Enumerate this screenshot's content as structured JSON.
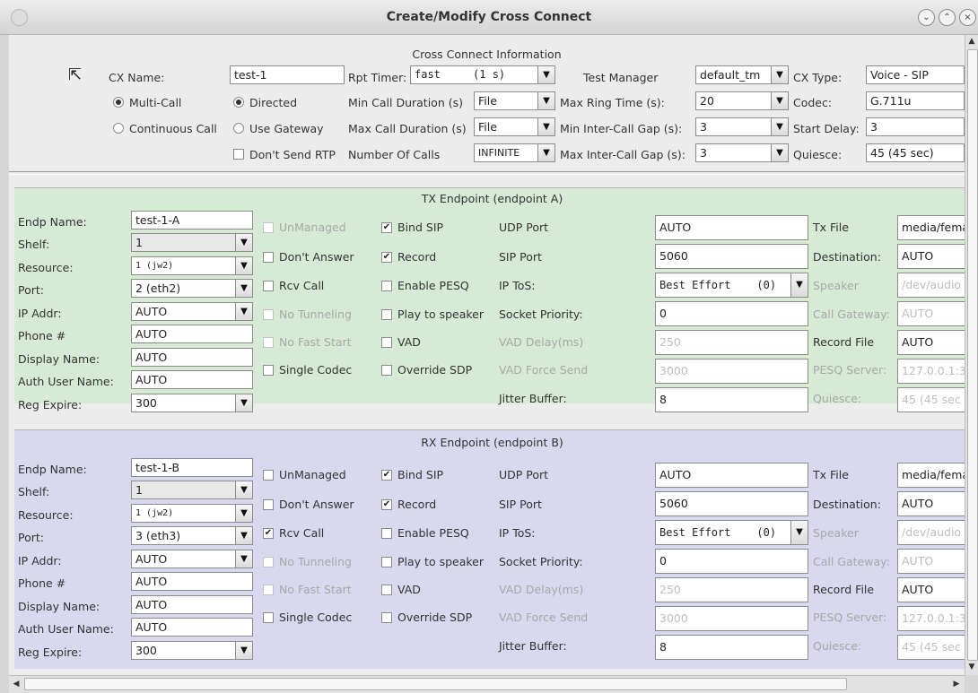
{
  "window": {
    "title": "Create/Modify Cross Connect"
  },
  "cx": {
    "section_title": "Cross Connect Information",
    "cx_name_label": "CX Name:",
    "cx_name": "test-1",
    "rpt_timer_label": "Rpt Timer:",
    "rpt_timer": "fast",
    "rpt_timer_sub": "(1 s)",
    "test_manager_label": "Test Manager",
    "test_manager": "default_tm",
    "cx_type_label": "CX Type:",
    "cx_type": "Voice - SIP",
    "multi_call": "Multi-Call",
    "continuous_call": "Continuous Call",
    "directed": "Directed",
    "use_gateway": "Use Gateway",
    "dont_send_rtp": "Don't Send RTP",
    "min_call_dur_label": "Min Call Duration (s)",
    "min_call_dur": "File",
    "max_call_dur_label": "Max Call Duration (s)",
    "max_call_dur": "File",
    "num_calls_label": "Number Of Calls",
    "num_calls": "INFINITE",
    "max_ring_label": "Max Ring Time (s):",
    "max_ring": "20",
    "min_gap_label": "Min Inter-Call Gap (s):",
    "min_gap": "3",
    "max_gap_label": "Max Inter-Call Gap (s):",
    "max_gap": "3",
    "codec_label": "Codec:",
    "codec": "G.711u",
    "start_delay_label": "Start Delay:",
    "start_delay": "3",
    "quiesce_label": "Quiesce:",
    "quiesce": "45 (45 sec)"
  },
  "labels": {
    "endp_name": "Endp Name:",
    "shelf": "Shelf:",
    "resource": "Resource:",
    "port": "Port:",
    "ip_addr": "IP Addr:",
    "phone": "Phone #",
    "display_name": "Display Name:",
    "auth_user": "Auth User Name:",
    "reg_expire": "Reg Expire:",
    "unmanaged": "UnManaged",
    "dont_answer": "Don't Answer",
    "rcv_call": "Rcv Call",
    "no_tunneling": "No Tunneling",
    "no_fast_start": "No Fast Start",
    "single_codec": "Single Codec",
    "bind_sip": "Bind SIP",
    "record": "Record",
    "enable_pesq": "Enable PESQ",
    "play_to_speaker": "Play to speaker",
    "vad": "VAD",
    "override_sdp": "Override SDP",
    "udp_port": "UDP Port",
    "sip_port": "SIP Port",
    "ip_tos": "IP ToS:",
    "socket_priority": "Socket Priority:",
    "vad_delay": "VAD Delay(ms)",
    "vad_force_send": "VAD Force Send",
    "jitter_buffer": "Jitter Buffer:",
    "tx_file": "Tx File",
    "destination": "Destination:",
    "speaker": "Speaker",
    "call_gateway": "Call Gateway:",
    "record_file": "Record File",
    "pesq_server": "PESQ Server:",
    "quiesce": "Quiesce:"
  },
  "tx": {
    "section_title": "TX Endpoint (endpoint A)",
    "endp_name": "test-1-A",
    "shelf": "1",
    "resource": "1 (jw2)",
    "port": "2 (eth2)",
    "ip_addr": "AUTO",
    "phone": "AUTO",
    "display_name": "AUTO",
    "auth_user": "AUTO",
    "reg_expire": "300",
    "udp_port": "AUTO",
    "sip_port": "5060",
    "ip_tos": "Best Effort    (0)",
    "socket_priority": "0",
    "vad_delay": "250",
    "vad_force_send": "3000",
    "jitter_buffer": "8",
    "tx_file": "media/fema",
    "destination": "AUTO",
    "speaker": "/dev/audio",
    "call_gateway": "AUTO",
    "record_file": "AUTO",
    "pesq_server": "127.0.0.1:3",
    "quiesce": "45 (45 sec"
  },
  "rx": {
    "section_title": "RX Endpoint (endpoint B)",
    "endp_name": "test-1-B",
    "shelf": "1",
    "resource": "1 (jw2)",
    "port": "3 (eth3)",
    "ip_addr": "AUTO",
    "phone": "AUTO",
    "display_name": "AUTO",
    "auth_user": "AUTO",
    "reg_expire": "300",
    "udp_port": "AUTO",
    "sip_port": "5060",
    "ip_tos": "Best Effort    (0)",
    "socket_priority": "0",
    "vad_delay": "250",
    "vad_force_send": "3000",
    "jitter_buffer": "8",
    "tx_file": "media/fema",
    "destination": "AUTO",
    "speaker": "/dev/audio",
    "call_gateway": "AUTO",
    "record_file": "AUTO",
    "pesq_server": "127.0.0.1:3",
    "quiesce": "45 (45 sec"
  },
  "colors": {
    "tx_panel": "#d6ead6",
    "rx_panel": "#d8d8ee"
  }
}
